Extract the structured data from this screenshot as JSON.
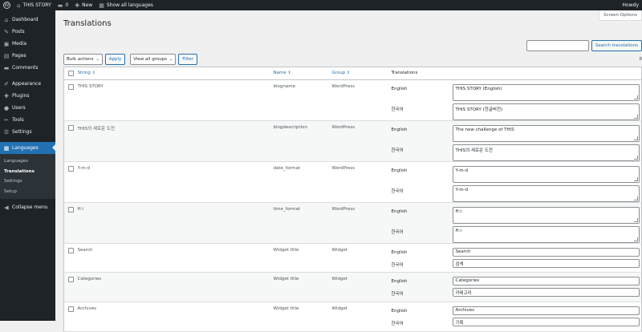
{
  "adminbar": {
    "site_name": "THIS STORY",
    "comments_count": "0",
    "new_label": "New",
    "show_all_label": "Show all languages",
    "howdy": "Howdy"
  },
  "sidebar": {
    "items": [
      {
        "label": "Dashboard",
        "icon": "dashboard-icon",
        "glyph": "⌂"
      },
      {
        "label": "Posts",
        "icon": "pushpin-icon",
        "glyph": "✎"
      },
      {
        "label": "Media",
        "icon": "media-icon",
        "glyph": "▣"
      },
      {
        "label": "Pages",
        "icon": "pages-icon",
        "glyph": "▤"
      },
      {
        "label": "Comments",
        "icon": "comment-icon",
        "glyph": "▬"
      },
      {
        "label": "Appearance",
        "icon": "brush-icon",
        "glyph": "✐"
      },
      {
        "label": "Plugins",
        "icon": "plug-icon",
        "glyph": "✚"
      },
      {
        "label": "Users",
        "icon": "user-icon",
        "glyph": "●"
      },
      {
        "label": "Tools",
        "icon": "wrench-icon",
        "glyph": "✂"
      },
      {
        "label": "Settings",
        "icon": "settings-icon",
        "glyph": "☰"
      },
      {
        "label": "Languages",
        "icon": "languages-icon",
        "glyph": "▦"
      }
    ],
    "submenu": [
      "Languages",
      "Translations",
      "Settings",
      "Setup"
    ],
    "collapse_label": "Collapse menu"
  },
  "screen_options_label": "Screen Options",
  "page_title": "Translations",
  "search": {
    "button_label": "Search translations"
  },
  "tablenav": {
    "bulk_actions": "Bulk actions",
    "apply_label": "Apply",
    "groups_select": "View all groups",
    "filter_label": "Filter",
    "pager": "8"
  },
  "table": {
    "headers": {
      "string": "String",
      "name": "Name",
      "group": "Group",
      "translations": "Translations"
    },
    "rows": [
      {
        "string": "THIS STORY",
        "name": "blogname",
        "group": "WordPress",
        "type": "ta",
        "translations": [
          {
            "lang": "English",
            "value": "THIS STORY (English)"
          },
          {
            "lang": "한국어",
            "value": "THIS STORY (한글버전)"
          }
        ]
      },
      {
        "string": "THIS의 새로운 도전",
        "name": "blogdescription",
        "group": "WordPress",
        "type": "ta",
        "translations": [
          {
            "lang": "English",
            "value": "The new challenge of THIS"
          },
          {
            "lang": "한국어",
            "value": "THIS의 새로운 도전"
          }
        ]
      },
      {
        "string": "Y-m-d",
        "name": "date_format",
        "group": "WordPress",
        "type": "ta",
        "translations": [
          {
            "lang": "English",
            "value": "Y-m-d"
          },
          {
            "lang": "한국어",
            "value": "Y-m-d"
          }
        ]
      },
      {
        "string": "H:i",
        "name": "time_format",
        "group": "WordPress",
        "type": "ta",
        "translations": [
          {
            "lang": "English",
            "value": "H:i"
          },
          {
            "lang": "한국어",
            "value": "H:i"
          }
        ]
      },
      {
        "string": "Search",
        "name": "Widget title",
        "group": "Widget",
        "type": "in",
        "translations": [
          {
            "lang": "English",
            "value": "Search"
          },
          {
            "lang": "한국어",
            "value": "검색"
          }
        ]
      },
      {
        "string": "Categories",
        "name": "Widget title",
        "group": "Widget",
        "type": "in",
        "translations": [
          {
            "lang": "English",
            "value": "Categories"
          },
          {
            "lang": "한국어",
            "value": "카테고리"
          }
        ]
      },
      {
        "string": "Archives",
        "name": "Widget title",
        "group": "Widget",
        "type": "in",
        "translations": [
          {
            "lang": "English",
            "value": "Archives"
          },
          {
            "lang": "한국어",
            "value": "기록"
          }
        ]
      }
    ]
  }
}
